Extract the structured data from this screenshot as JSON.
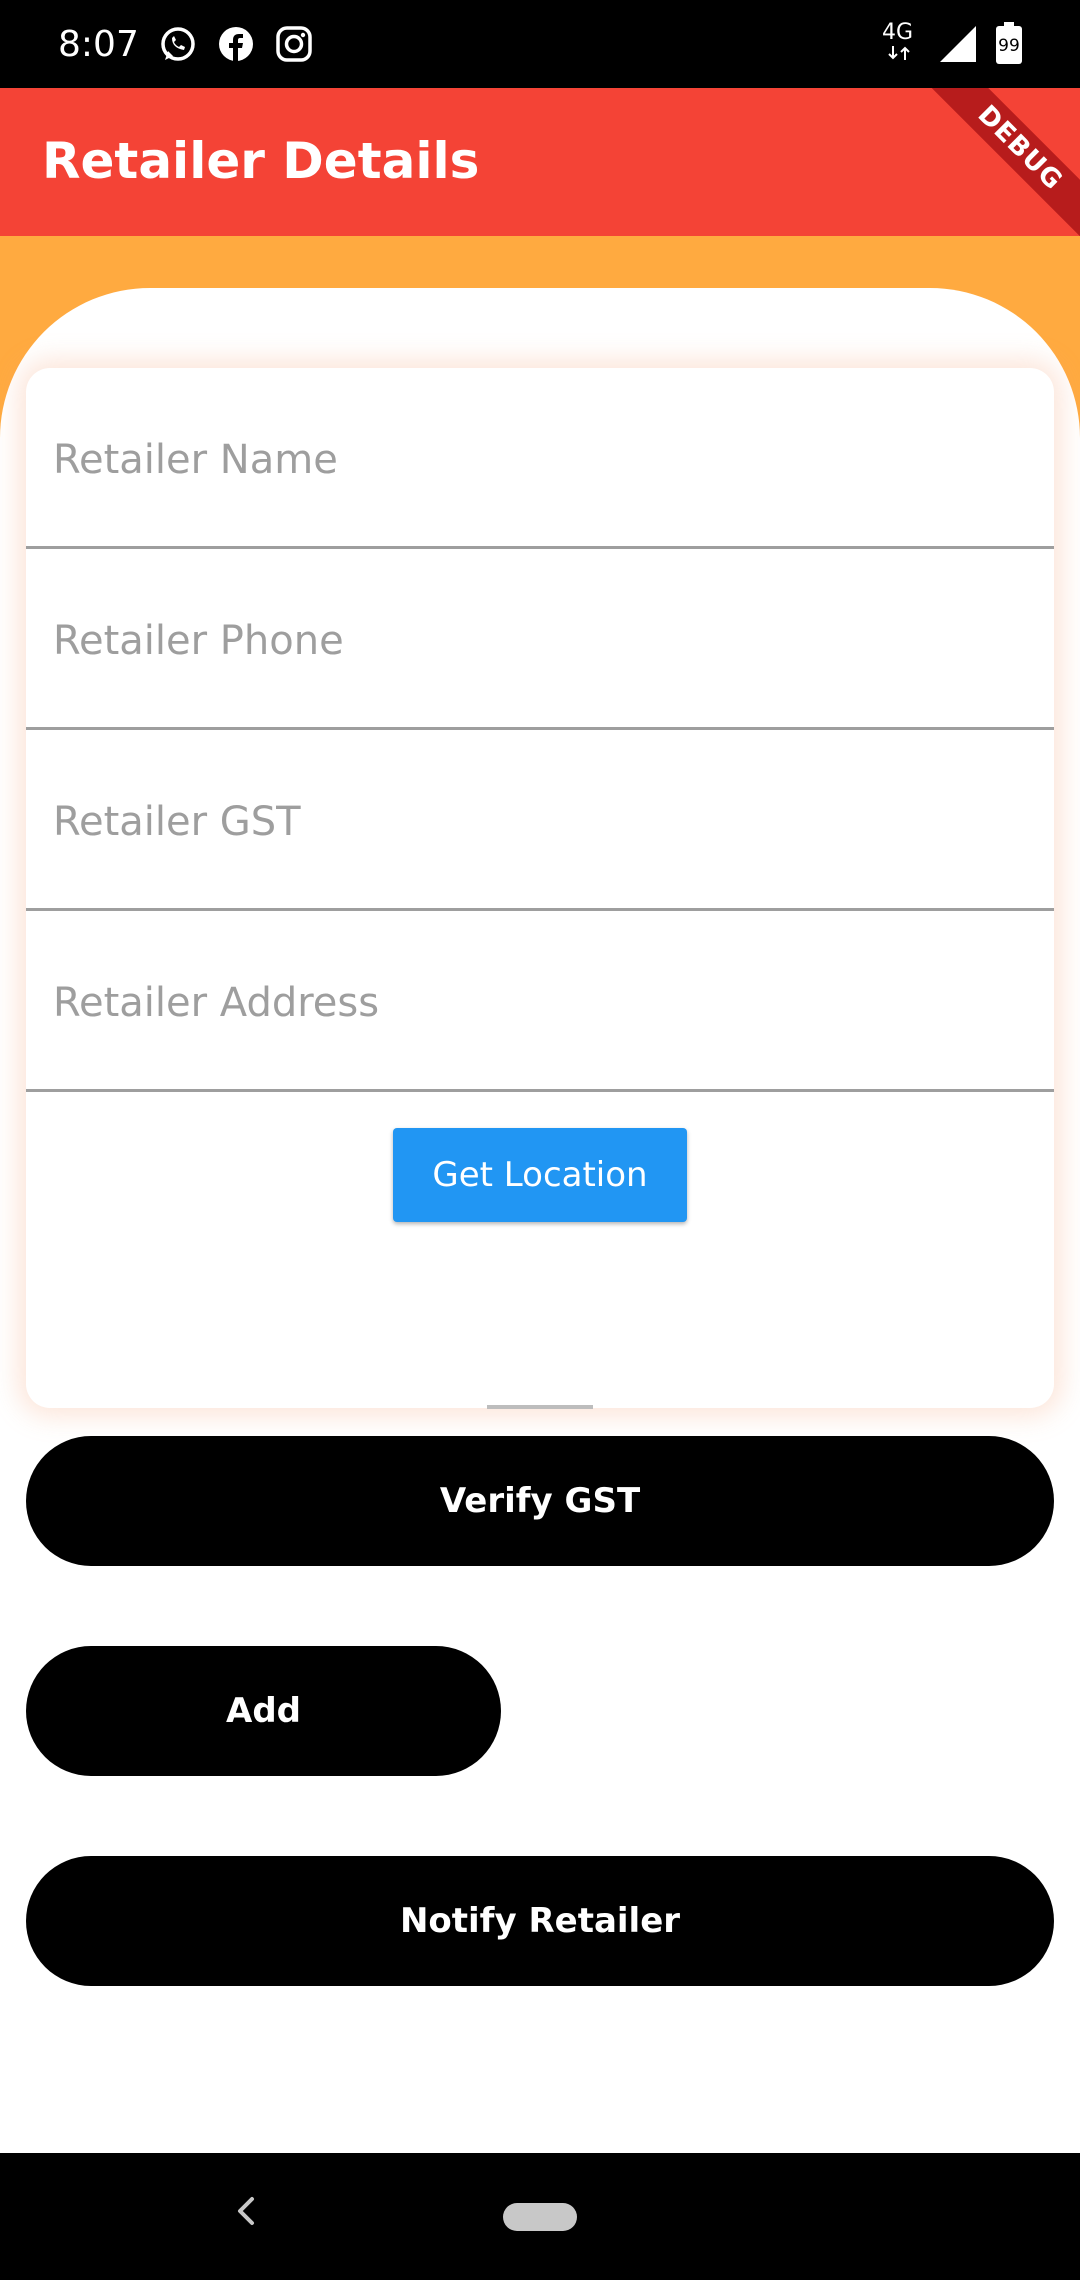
{
  "status_bar": {
    "time": "8:07",
    "network": "4G",
    "battery": "99",
    "left_icons": [
      "whatsapp-icon",
      "facebook-icon",
      "instagram-icon"
    ],
    "right_icons": [
      "network-4g-icon",
      "signal-icon",
      "battery-icon"
    ]
  },
  "app_bar": {
    "title": "Retailer Details",
    "debug_badge": "DEBUG",
    "color": "#f44336"
  },
  "form": {
    "fields": [
      {
        "placeholder": "Retailer Name",
        "value": ""
      },
      {
        "placeholder": "Retailer Phone",
        "value": ""
      },
      {
        "placeholder": "Retailer GST",
        "value": ""
      },
      {
        "placeholder": "Retailer Address",
        "value": ""
      }
    ],
    "get_location_label": "Get Location",
    "button_color": "#2196f3"
  },
  "actions": {
    "verify_gst_label": "Verify GST",
    "add_label": "Add",
    "notify_label": "Notify Retailer"
  },
  "colors": {
    "orange_background": "#ffaa40",
    "pill_button": "#000000"
  },
  "nav_bar": {
    "icons": [
      "back-icon",
      "home-pill-icon"
    ]
  }
}
